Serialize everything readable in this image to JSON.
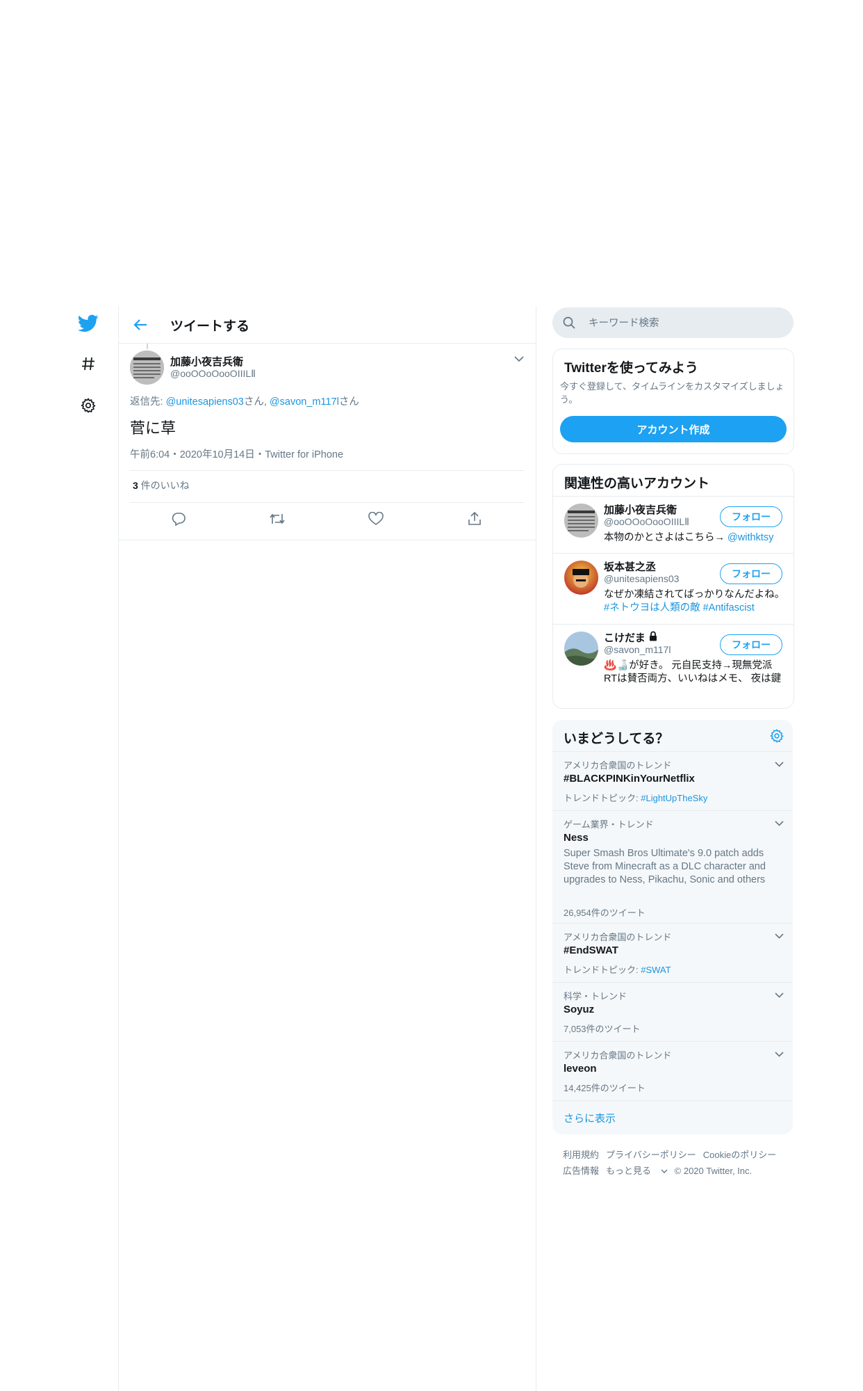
{
  "colors": {
    "accent": "#1da1f2",
    "link": "#1b95e0",
    "text": "#14171a",
    "secondary": "#657786",
    "border": "#e6ecf0"
  },
  "nav": {
    "icons": [
      "twitter-logo-icon",
      "hashtag-icon",
      "gear-icon"
    ]
  },
  "header": {
    "title": "ツイートする"
  },
  "tweet": {
    "author_name": "加藤小夜吉兵衛",
    "author_handle": "@ooOOoOooOIIILⅡ",
    "reply_prefix": "返信先: ",
    "reply_user1": "@unitesapiens03",
    "reply_san1": "さん, ",
    "reply_user2": "@savon_m117l",
    "reply_san2": "さん",
    "text": "菅に草",
    "time": "午前6:04・2020年10月14日・Twitter for iPhone",
    "likes_count": "3",
    "likes_label": " 件のいいね"
  },
  "search": {
    "placeholder": "キーワード検索"
  },
  "signup": {
    "title": "Twitterを使ってみよう",
    "description": "今すぐ登録して、タイムラインをカスタマイズしましょう。",
    "button": "アカウント作成"
  },
  "related": {
    "title": "関連性の高いアカウント",
    "follow_label": "フォロー",
    "accounts": [
      {
        "name": "加藤小夜吉兵衛",
        "handle": "@ooOOoOooOIIILⅡ",
        "bio_text": "本物のかとさよはこちら→ ",
        "bio_link": "@withktsy"
      },
      {
        "name": "坂本甚之丞",
        "handle": "@unitesapiens03",
        "bio_text": "なぜか凍結されてばっかりなんだよね。 ",
        "bio_link": "#ネトウヨは人類の敵 #Antifascist"
      },
      {
        "name": "こけだま",
        "handle": "@savon_m117l",
        "bio_text": "♨️🍶が好き。 元自民支持→現無党派 RTは賛否両方、いいねはメモ、 夜は鍵",
        "bio_link": ""
      }
    ]
  },
  "trends": {
    "title": "いまどうしてる？",
    "items": [
      {
        "category": "アメリカ合衆国のトレンド",
        "name": "#BLACKPINKinYourNetflix",
        "sub_label": "トレンドトピック: ",
        "sub_link": "#LightUpTheSky"
      },
      {
        "category": "ゲーム業界・トレンド",
        "name": "Ness",
        "description": "Super Smash Bros Ultimate's 9.0 patch adds Steve from Minecraft as a DLC character and upgrades to Ness, Pikachu, Sonic and others",
        "count": "26,954件のツイート"
      },
      {
        "category": "アメリカ合衆国のトレンド",
        "name": "#EndSWAT",
        "sub_label": "トレンドトピック: ",
        "sub_link": "#SWAT"
      },
      {
        "category": "科学・トレンド",
        "name": "Soyuz",
        "count": "7,053件のツイート"
      },
      {
        "category": "アメリカ合衆国のトレンド",
        "name": "leveon",
        "count": "14,425件のツイート"
      }
    ],
    "show_more": "さらに表示"
  },
  "footer": {
    "links_row1": [
      "利用規約",
      "プライバシーポリシー",
      "Cookieのポリシー"
    ],
    "links_row2": [
      "広告情報",
      "もっと見る"
    ],
    "copyright": "© 2020 Twitter, Inc."
  }
}
